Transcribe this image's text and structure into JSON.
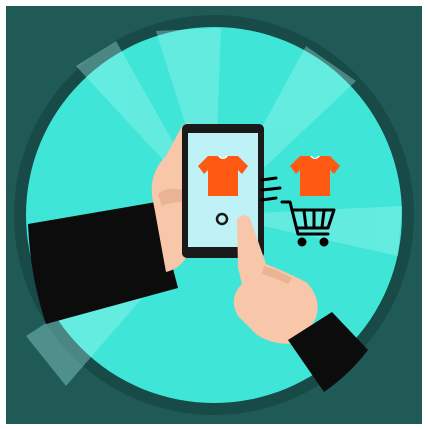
{
  "scene": {
    "subject": "hand-holding-smartphone-shopping",
    "colors": {
      "background": "#1f5a57",
      "ring": "#184a48",
      "circle": "#3fe6d8",
      "circle_light": "#6ff0e6",
      "sleeve": "#0c0c0c",
      "skin": "#f8c6a8",
      "phone_body": "#1a1a1a",
      "phone_screen": "#bff2f7",
      "shirt": "#ff5a14",
      "cart": "#000000"
    },
    "icons": [
      "tshirt-icon",
      "shopping-cart-icon",
      "speed-lines-icon"
    ]
  }
}
